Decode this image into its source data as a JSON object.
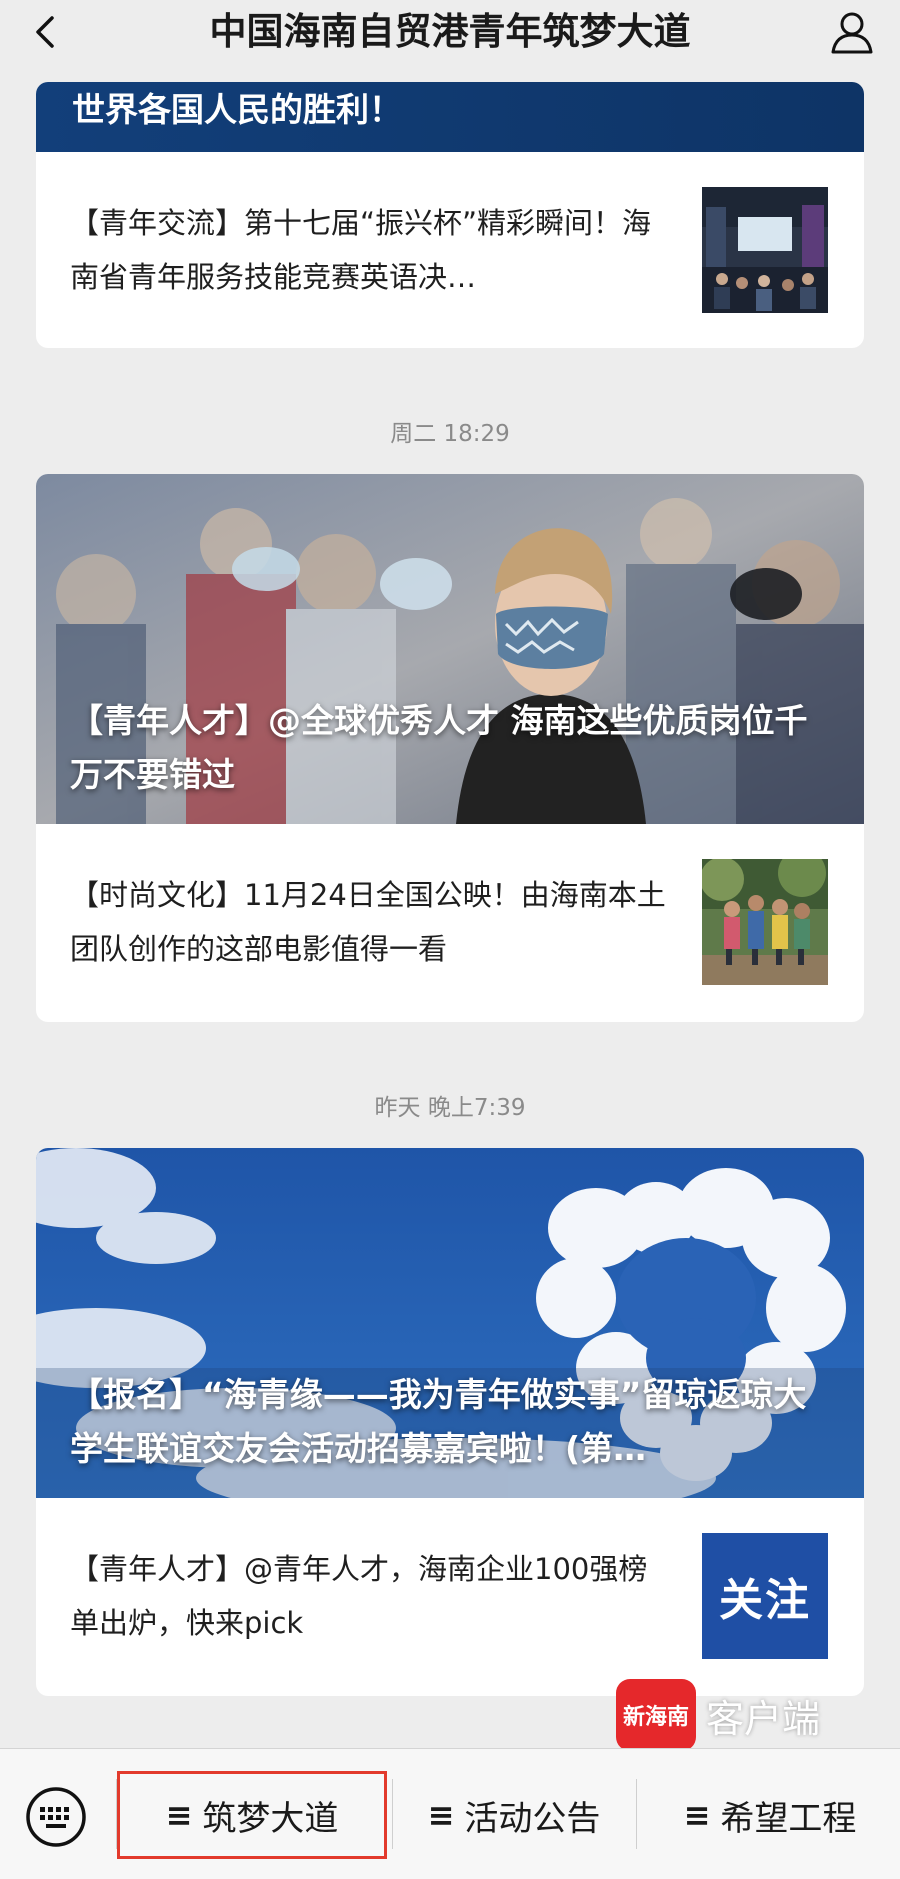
{
  "header": {
    "title": "中国海南自贸港青年筑梦大道"
  },
  "articles_group1": {
    "hero_caption": "世界各国人民的胜利！",
    "items": [
      {
        "text": "【青年交流】第十七届“振兴杯”精彩瞬间！海南省青年服务技能竞赛英语决…"
      }
    ]
  },
  "group2": {
    "time": "周二 18:29",
    "hero_caption": "【青年人才】@全球优秀人才 海南这些优质岗位千万不要错过",
    "items": [
      {
        "text": "【时尚文化】11月24日全国公映！由海南本土团队创作的这部电影值得一看"
      }
    ]
  },
  "group3": {
    "time": "昨天 晚上7:39",
    "hero_caption": "【报名】“海青缘——我为青年做实事”留琼返琼大学生联谊交友会活动招募嘉宾啦！(第…",
    "items": [
      {
        "text": "【青年人才】@青年人才，海南企业100强榜单出炉，快来pick",
        "thumb_label": "关注"
      }
    ]
  },
  "bottom_menu": {
    "items": [
      {
        "label": "筑梦大道",
        "highlighted": true
      },
      {
        "label": "活动公告"
      },
      {
        "label": "希望工程"
      }
    ]
  },
  "watermark": {
    "logo_text": "新海南",
    "text": "客户端"
  },
  "icons": [
    "back-icon",
    "user-icon",
    "keyboard-icon",
    "menu-icon"
  ],
  "colors": {
    "background": "#ededed",
    "highlight_border": "#e23a2c",
    "brand_red": "#e5282b",
    "follow_blue": "#1f4fa5"
  }
}
